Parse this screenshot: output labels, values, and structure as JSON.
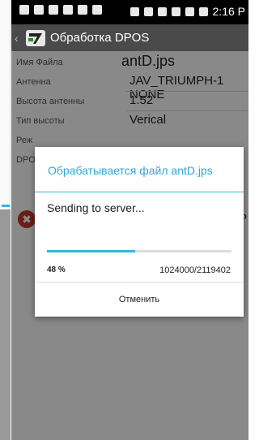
{
  "status_bar": {
    "time": "2:16 P"
  },
  "app_bar": {
    "title": "Обработка DPOS",
    "logo_icon": "app-logo-icon"
  },
  "form": {
    "rows": [
      {
        "label": "Имя Файла",
        "value": "antD.jps"
      },
      {
        "label": "Антенна",
        "value": "JAV_TRIUMPH-1 NONE"
      },
      {
        "label": "Высота антенны",
        "value": "1.52"
      },
      {
        "label": "Тип высоты",
        "value": "Verical"
      },
      {
        "label": "Реж",
        "value": ""
      },
      {
        "label": "DPO",
        "value": ""
      }
    ],
    "truncated_right": "P"
  },
  "dialog": {
    "title": "Обрабатывается файл antD.jps",
    "message": "Sending to server...",
    "progress_fraction": 0.48,
    "percent_label": "48 %",
    "count_label": "1024000/2119402",
    "cancel_label": "Отменить"
  },
  "colors": {
    "accent": "#33b5e5",
    "actionbar": "#4a4a4a",
    "error": "#c0392b"
  }
}
